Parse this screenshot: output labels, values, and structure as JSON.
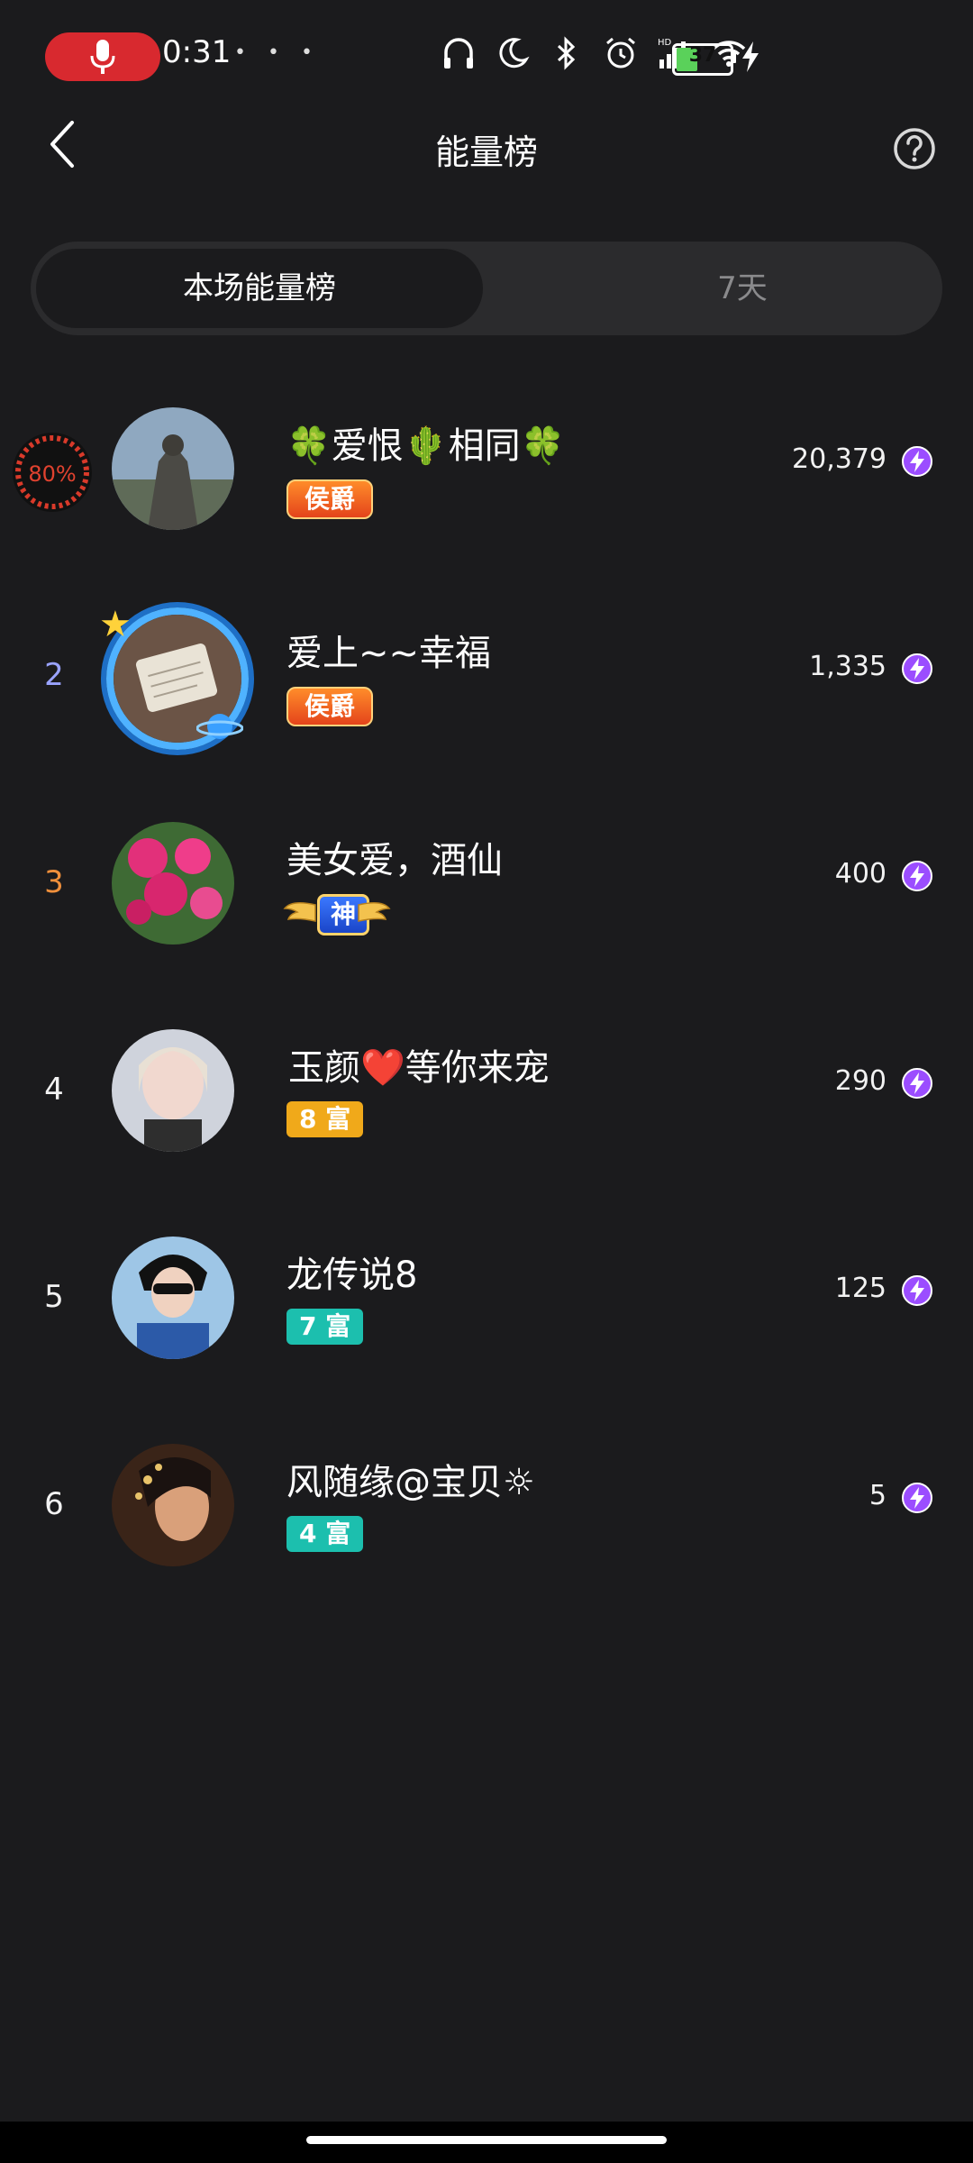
{
  "status_bar": {
    "time": "0:31",
    "battery": "37",
    "mini_icons": [
      "•",
      "•",
      "•"
    ]
  },
  "header": {
    "title": "能量榜"
  },
  "tabs": [
    {
      "label": "本场能量榜",
      "active": true
    },
    {
      "label": "7天",
      "active": false
    }
  ],
  "top_progress": "80%",
  "ranking": [
    {
      "rank": "",
      "name": "🍀爱恨🌵相同🍀",
      "badge": "侯爵",
      "badge_type": "noble",
      "score": "20,379"
    },
    {
      "rank": "2",
      "name": "爱上~~幸福",
      "badge": "侯爵",
      "badge_type": "noble",
      "score": "1,335"
    },
    {
      "rank": "3",
      "name": "美女爱，酒仙",
      "badge": "神",
      "badge_type": "god",
      "score": "400"
    },
    {
      "rank": "4",
      "name": "玉颜❤️等你来宠",
      "badge": "8 富",
      "badge_type": "rich-orange",
      "score": "290"
    },
    {
      "rank": "5",
      "name": "龙传说8",
      "badge": "7 富",
      "badge_type": "rich-teal",
      "score": "125"
    },
    {
      "rank": "6",
      "name": "风随缘@宝贝☼",
      "badge": "4 富",
      "badge_type": "rich-teal",
      "score": "5"
    }
  ],
  "colors": {
    "background": "#1b1b1d",
    "rank2": "#9aa3ff",
    "rank3": "#f1903b",
    "energy": "#9b4dff"
  }
}
